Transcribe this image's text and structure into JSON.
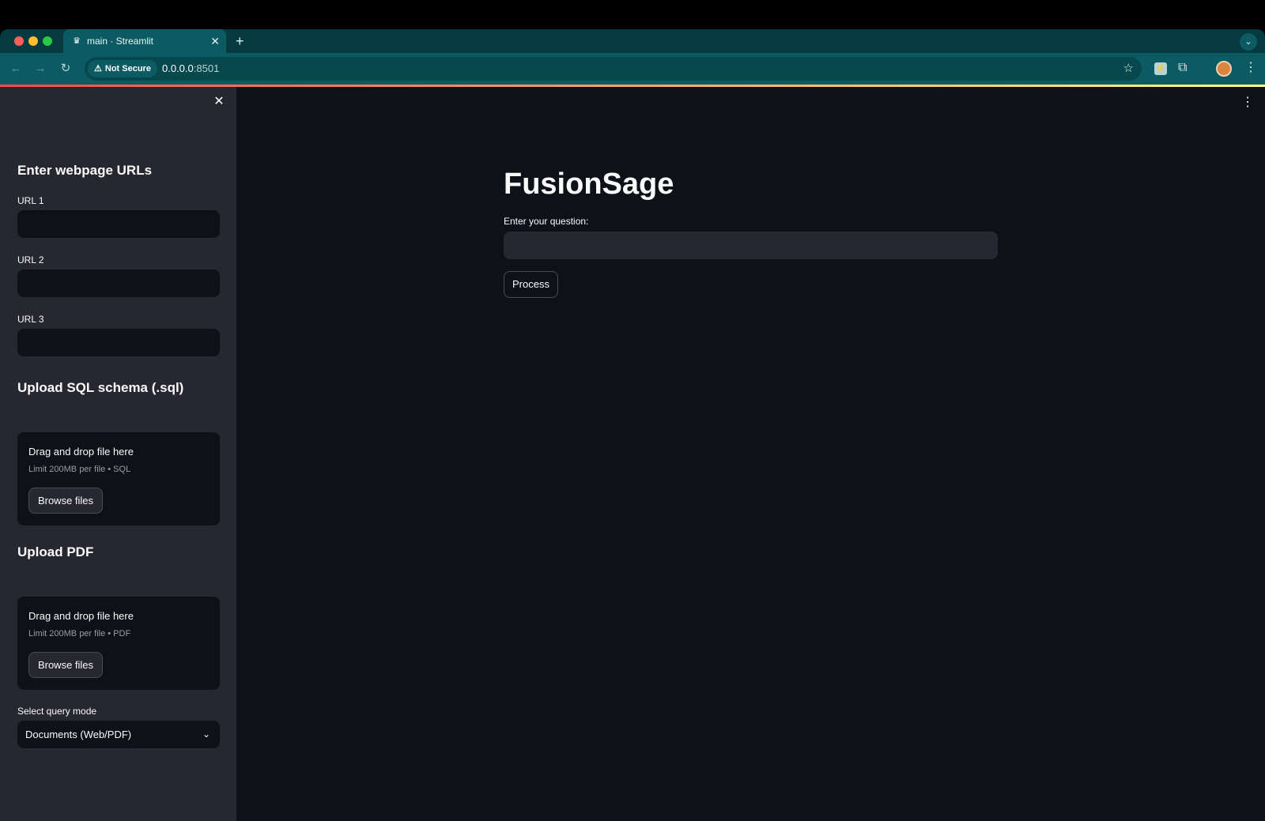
{
  "browser": {
    "tab_title": "main · Streamlit",
    "security_label": "Not Secure",
    "url_host": "0.0.0.0",
    "url_port": ":8501"
  },
  "sidebar": {
    "urls_heading": "Enter webpage URLs",
    "url_fields": [
      {
        "label": "URL 1",
        "value": ""
      },
      {
        "label": "URL 2",
        "value": ""
      },
      {
        "label": "URL 3",
        "value": ""
      }
    ],
    "sql_heading": "Upload SQL schema (.sql)",
    "sql_uploader": {
      "title": "Drag and drop file here",
      "limit": "Limit 200MB per file • SQL",
      "button": "Browse files"
    },
    "pdf_heading": "Upload PDF",
    "pdf_uploader": {
      "title": "Drag and drop file here",
      "limit": "Limit 200MB per file • PDF",
      "button": "Browse files"
    },
    "mode_label": "Select query mode",
    "mode_value": "Documents (Web/PDF)"
  },
  "main": {
    "title": "FusionSage",
    "question_label": "Enter your question:",
    "question_value": "",
    "process_button": "Process"
  },
  "colors": {
    "tab_strip": "#053a41",
    "toolbar": "#0c5b62",
    "sidebar_bg": "#262730",
    "main_bg": "#0e1117",
    "text": "#fafafa"
  }
}
